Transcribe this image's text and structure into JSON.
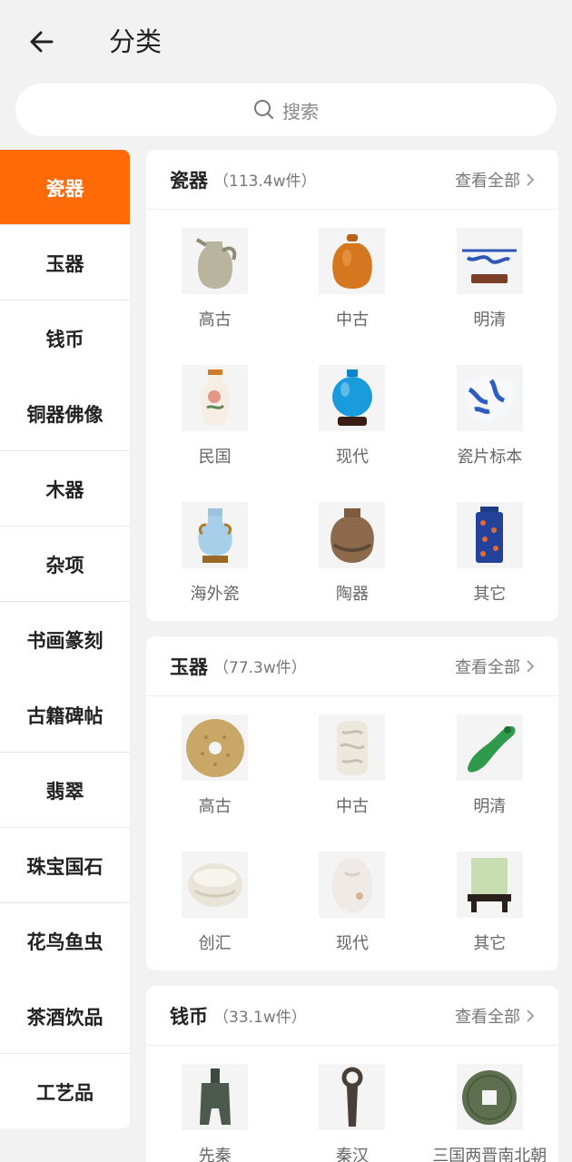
{
  "header": {
    "title": "分类"
  },
  "search": {
    "placeholder": "搜索"
  },
  "sidebar": {
    "items": [
      {
        "label": "瓷器",
        "active": true
      },
      {
        "label": "玉器"
      },
      {
        "label": "钱币"
      },
      {
        "label": "铜器佛像"
      },
      {
        "label": "木器"
      },
      {
        "label": "杂项"
      },
      {
        "label": "书画篆刻"
      },
      {
        "label": "古籍碑帖"
      },
      {
        "label": "翡翠"
      },
      {
        "label": "珠宝国石"
      },
      {
        "label": "花鸟鱼虫"
      },
      {
        "label": "茶酒饮品"
      },
      {
        "label": "工艺品"
      }
    ],
    "active_color": "#fe6a06"
  },
  "sections": [
    {
      "name": "瓷器",
      "count": "（113.4w件）",
      "view_all": "查看全部",
      "items": [
        {
          "label": "高古",
          "icon": "ewer-icon"
        },
        {
          "label": "中古",
          "icon": "jar-icon"
        },
        {
          "label": "明清",
          "icon": "bowl-icon"
        },
        {
          "label": "民国",
          "icon": "vase-icon"
        },
        {
          "label": "现代",
          "icon": "blue-vase-icon"
        },
        {
          "label": "瓷片标本",
          "icon": "shard-icon"
        },
        {
          "label": "海外瓷",
          "icon": "handled-vase-icon"
        },
        {
          "label": "陶器",
          "icon": "pottery-icon"
        },
        {
          "label": "其它",
          "icon": "square-vase-icon"
        }
      ]
    },
    {
      "name": "玉器",
      "count": "（77.3w件）",
      "view_all": "查看全部",
      "items": [
        {
          "label": "高古",
          "icon": "jade-disc-icon"
        },
        {
          "label": "中古",
          "icon": "jade-carving-icon"
        },
        {
          "label": "明清",
          "icon": "green-jade-icon"
        },
        {
          "label": "创汇",
          "icon": "jade-bangle-icon"
        },
        {
          "label": "现代",
          "icon": "jade-pebble-icon"
        },
        {
          "label": "其它",
          "icon": "jade-screen-icon"
        }
      ]
    },
    {
      "name": "钱币",
      "count": "（33.1w件）",
      "view_all": "查看全部",
      "items": [
        {
          "label": "先秦",
          "icon": "spade-coin-icon"
        },
        {
          "label": "秦汉",
          "icon": "knife-coin-icon"
        },
        {
          "label": "三国两晋南北朝",
          "icon": "round-coin-icon"
        }
      ]
    }
  ]
}
